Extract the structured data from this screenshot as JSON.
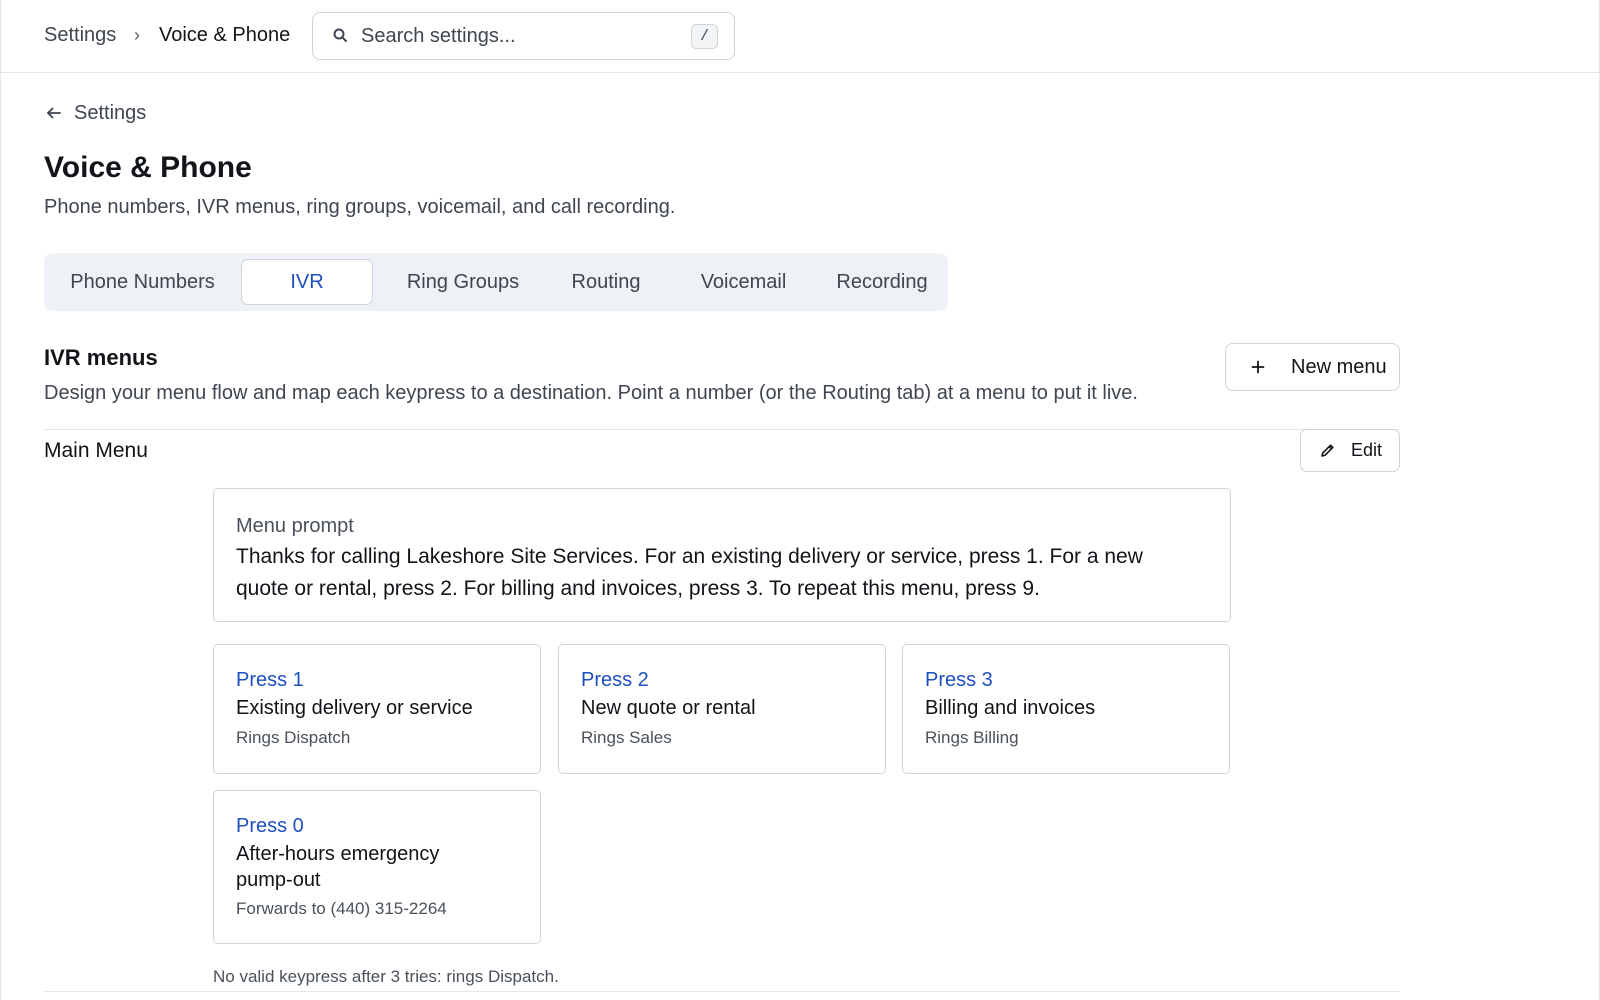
{
  "breadcrumb": {
    "root": "Settings",
    "separator": "›",
    "current": "Voice & Phone"
  },
  "search": {
    "placeholder": "Search settings...",
    "shortcut": "/"
  },
  "back_link": {
    "label": "Settings"
  },
  "page": {
    "title": "Voice & Phone",
    "description": "Phone numbers, IVR menus, ring groups, voicemail, and call recording."
  },
  "tabs": [
    {
      "label": "Phone Numbers"
    },
    {
      "label": "IVR",
      "active": true
    },
    {
      "label": "Ring Groups"
    },
    {
      "label": "Routing"
    },
    {
      "label": "Voicemail"
    },
    {
      "label": "Recording"
    }
  ],
  "section": {
    "title": "IVR menus",
    "description": "Design your menu flow and map each keypress to a destination. Point a number (or the Routing tab) at a menu to put it live.",
    "new_button": "New menu"
  },
  "menu": {
    "name": "Main Menu",
    "edit_button": "Edit",
    "prompt_label": "Menu prompt",
    "prompt_text": "Thanks for calling Lakeshore Site Services. For an existing delivery or service, press 1. For a new quote or rental, press 2. For billing and invoices, press 3. To repeat this menu, press 9.",
    "keys": [
      {
        "title": "Press 1",
        "description": "Existing delivery or service",
        "destination": "Rings Dispatch"
      },
      {
        "title": "Press 2",
        "description": "New quote or rental",
        "destination": "Rings Sales"
      },
      {
        "title": "Press 3",
        "description": "Billing and invoices",
        "destination": "Rings Billing"
      },
      {
        "title": "Press 0",
        "description": "After-hours emergency pump-out",
        "destination": "Forwards to (440) 315-2264"
      }
    ],
    "fallback_note": "No valid keypress after 3 tries: rings Dispatch."
  },
  "icons": {
    "search": "search-icon",
    "back": "arrow-left-icon",
    "plus": "plus-icon",
    "edit": "pencil-icon"
  },
  "colors": {
    "accent": "#1f4fbf",
    "border": "#cfd4da",
    "tab_background": "#eef1f5",
    "text_primary": "#111418",
    "text_secondary": "#3f4650"
  }
}
